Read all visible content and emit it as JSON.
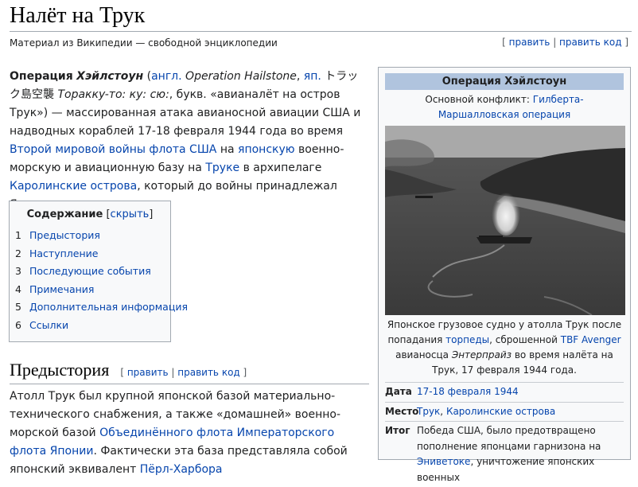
{
  "page": {
    "title": "Налёт на Трук",
    "subtitle": "Материал из Википедии — свободной энциклопедии",
    "edit": "править",
    "edit_code": "править код"
  },
  "lead": {
    "bold_name": "Операция",
    "bold_italic": "Хэйлстоун",
    "paren_open": " (",
    "lang_en": "англ.",
    "en_name": " Operation Hailstone",
    "comma1": ", ",
    "lang_ja": "яп.",
    "ja_text": " トラック島空襲 ",
    "romaji": "Тораккy-то: ку: сю:",
    "rest1": ", букв. «авианалёт на остров Трук») — массированная атака авианосной авиации США и надводных кораблей 17-18 февраля 1944 года во время ",
    "link_war": "Второй мировой войны",
    "sp1": " ",
    "link_fleet": "флота США",
    "on": " на ",
    "link_japanese": "японскую",
    "rest2": " военно-морскую и авиационную базу на ",
    "link_truk": "Труке",
    "in_arch": " в архипелаге ",
    "link_carolines": "Каролинские острова",
    "rest3": ", который до войны принадлежал Японии."
  },
  "toc": {
    "heading": "Содержание",
    "toggle": "скрыть",
    "items": [
      {
        "num": "1",
        "label": "Предыстория"
      },
      {
        "num": "2",
        "label": "Наступление"
      },
      {
        "num": "3",
        "label": "Последующие события"
      },
      {
        "num": "4",
        "label": "Примечания"
      },
      {
        "num": "5",
        "label": "Дополнительная информация"
      },
      {
        "num": "6",
        "label": "Ссылки"
      }
    ]
  },
  "section": {
    "heading": "Предыстория",
    "edit": "править",
    "edit_code": "править код",
    "text1": "Атолл Трук был крупной японской базой материально-технического снабжения, а также «домашней» военно-морской базой ",
    "link_fleet": "Объединённого флота Императорского флота Японии",
    "text2": ". Фактически эта база представляла собой японский эквивалент ",
    "link_pearl": "Пёрл-Харбора"
  },
  "infobox": {
    "title": "Операция Хэйлстоун",
    "conflict_label": "Основной конфликт: ",
    "conflict_link": "Гилберта-Маршалловская операция",
    "caption_1": "Японское грузовое судно у атолла Трук после попадания ",
    "caption_link1": "торпеды",
    "caption_2": ", сброшенной ",
    "caption_link2": "TBF Avenger",
    "caption_3": " авианосца ",
    "caption_italic": "Энтерпрайз",
    "caption_4": " во время налёта на Трук, 17 февраля 1944 года.",
    "rows": [
      {
        "key": "Дата",
        "value_link": "17-18 февраля 1944"
      },
      {
        "key": "Место",
        "value_link": "Трук",
        "value_sep": ", ",
        "value_link2": "Каролинские острова"
      },
      {
        "key": "Итог",
        "value_text": "Победа США, было предотвращено пополнение японцами гарнизона на ",
        "value_link": "Эниветоке",
        "value_text2": ", уничтожение японских военных"
      }
    ]
  }
}
